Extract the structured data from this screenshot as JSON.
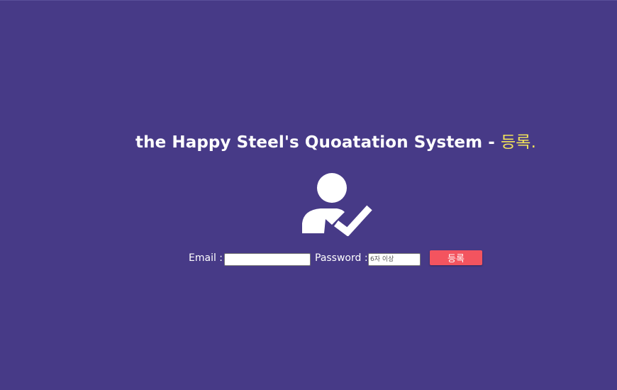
{
  "header": {
    "title_main": "the Happy Steel's Quoatation System - ",
    "title_accent": "등록."
  },
  "icon": {
    "name": "user-check-icon",
    "color": "#ffffff"
  },
  "form": {
    "email_label": "Email :",
    "email_value": "",
    "password_label": "Password :",
    "password_placeholder": "6자 이상",
    "submit_label": "등록"
  },
  "colors": {
    "background": "#473a87",
    "accent": "#f2e35a",
    "button": "#f3545f"
  }
}
